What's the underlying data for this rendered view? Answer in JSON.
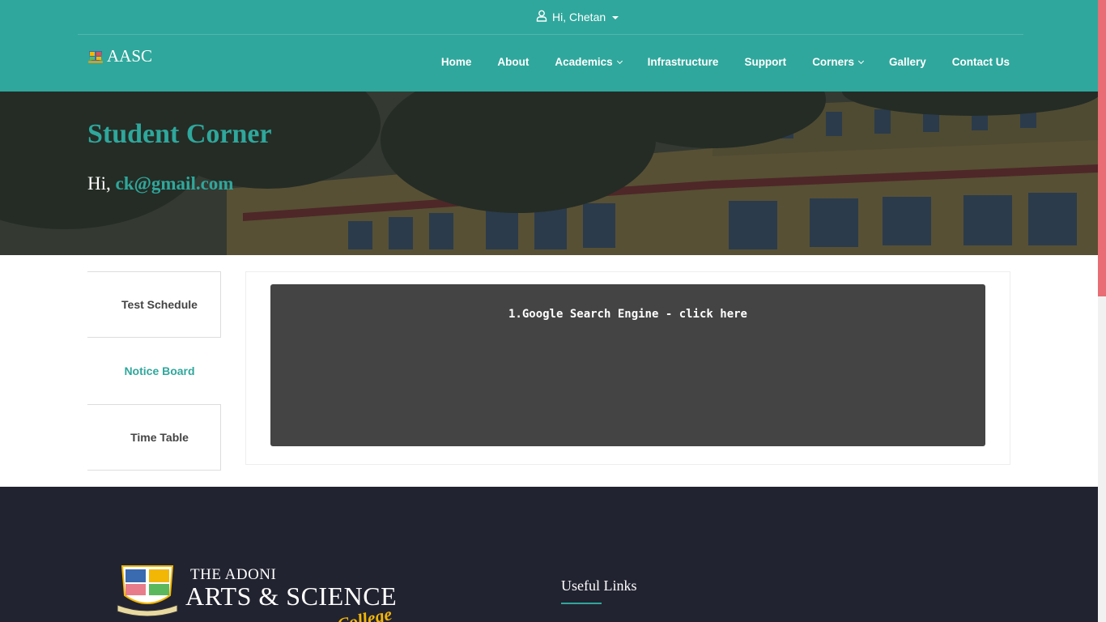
{
  "header": {
    "user_greeting": "Hi, Chetan",
    "brand": "AASC",
    "nav": [
      {
        "label": "Home"
      },
      {
        "label": "About"
      },
      {
        "label": "Academics",
        "has_dropdown": true
      },
      {
        "label": "Infrastructure"
      },
      {
        "label": "Support"
      },
      {
        "label": "Corners",
        "has_dropdown": true
      },
      {
        "label": "Gallery"
      },
      {
        "label": "Contact Us"
      }
    ]
  },
  "hero": {
    "title": "Student Corner",
    "greeting_prefix": "Hi, ",
    "email": "ck@gmail.com"
  },
  "sidebar": {
    "items": [
      {
        "label": "Test Schedule",
        "active": false
      },
      {
        "label": "Notice Board",
        "active": true
      },
      {
        "label": "Time Table",
        "active": false
      }
    ]
  },
  "notice_board": {
    "items": [
      "1.Google Search Engine - click here"
    ]
  },
  "footer": {
    "logo_line1": "THE ADONI",
    "logo_line2": "ARTS & SCIENCE",
    "logo_line3": "College",
    "useful_links_title": "Useful Links"
  },
  "colors": {
    "primary": "#2fa79c",
    "footer_bg": "#222330",
    "notice_bg": "#444444",
    "accent_yellow": "#f2b705",
    "scroll_thumb": "#e96d74"
  }
}
